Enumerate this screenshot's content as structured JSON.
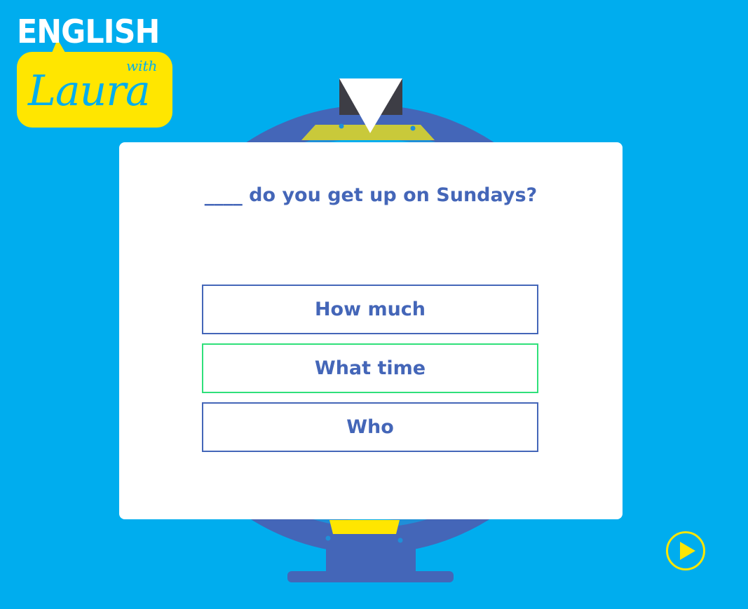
{
  "logo": {
    "word": "ENGLISH",
    "with": "with",
    "name": "Laura"
  },
  "quiz": {
    "question": "____ do you get up on Sundays?",
    "answers": [
      {
        "label": "How much",
        "selected": false
      },
      {
        "label": "What time",
        "selected": true
      },
      {
        "label": "Who",
        "selected": false
      }
    ]
  },
  "controls": {
    "play_icon": "play-icon"
  },
  "colors": {
    "background": "#00adee",
    "accent_blue": "#4466b8",
    "logo_yellow": "#ffe600",
    "selected_border": "#2fe07a"
  }
}
